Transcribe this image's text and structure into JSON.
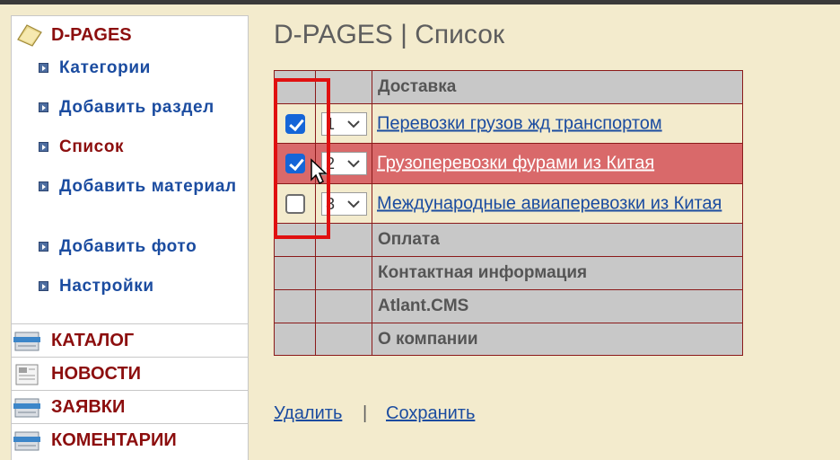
{
  "module": {
    "title": "D-PAGES",
    "icon": "folder-icon"
  },
  "nav": [
    {
      "label": "Категории",
      "active": false
    },
    {
      "label": "Добавить раздел",
      "active": false
    },
    {
      "label": "Список",
      "active": true
    },
    {
      "label": "Добавить материал",
      "active": false
    },
    {
      "label": "Добавить фото",
      "active": false
    },
    {
      "label": "Настройки",
      "active": false
    }
  ],
  "sections": [
    {
      "label": "КАТАЛОГ",
      "icon": "catalog-icon"
    },
    {
      "label": "НОВОСТИ",
      "icon": "news-icon"
    },
    {
      "label": "ЗАЯВКИ",
      "icon": "requests-icon"
    },
    {
      "label": "КОМЕНТАРИИ",
      "icon": "comments-icon"
    }
  ],
  "page": {
    "title": "D-PAGES | Список"
  },
  "table": {
    "rows": [
      {
        "kind": "group",
        "label": "Доставка"
      },
      {
        "kind": "item",
        "checked": true,
        "order": "1",
        "label": "Перевозки грузов жд транспортом",
        "selected": false
      },
      {
        "kind": "item",
        "checked": true,
        "order": "2",
        "label": "Грузоперевозки фурами из Китая",
        "selected": true
      },
      {
        "kind": "item",
        "checked": false,
        "order": "3",
        "label": "Международные авиаперевозки из Китая",
        "selected": false
      },
      {
        "kind": "group",
        "label": "Оплата"
      },
      {
        "kind": "group",
        "label": "Контактная информация"
      },
      {
        "kind": "group",
        "label": "Atlant.CMS"
      },
      {
        "kind": "group",
        "label": "О компании"
      }
    ]
  },
  "actions": {
    "delete_label": "Удалить",
    "separator": "|",
    "save_label": "Сохранить"
  },
  "colors": {
    "background": "#f3ebcd",
    "accent_red": "#8c0e0e",
    "link_blue": "#1b4ca0",
    "selected_row": "#d9696a",
    "group_row": "#c8c8c8",
    "highlight_box": "#e01010"
  }
}
